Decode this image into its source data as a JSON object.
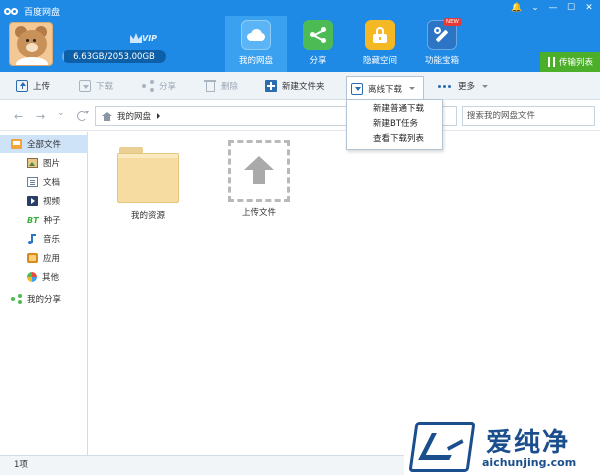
{
  "app": {
    "title": "百度网盘"
  },
  "window_controls": [
    "🔔",
    "⌄",
    "—",
    "☐",
    "✕"
  ],
  "user": {
    "quota_text": "6.63GB/2053.00GB",
    "quota_used_fraction": 0.0032,
    "vip_text": "VIP"
  },
  "nav_tabs": [
    {
      "label": "我的网盘",
      "icon": "cloud-disk-icon",
      "active": true
    },
    {
      "label": "分享",
      "icon": "share-icon",
      "active": false
    },
    {
      "label": "隐藏空间",
      "icon": "lock-icon",
      "active": false
    },
    {
      "label": "功能宝箱",
      "icon": "tools-icon",
      "active": false,
      "badge": "NEW"
    }
  ],
  "transfer_list_label": "传输列表",
  "toolbar": {
    "upload": "上传",
    "download": "下载",
    "share": "分享",
    "delete": "删除",
    "new_folder": "新建文件夹",
    "offline_download": "离线下载",
    "more": "更多"
  },
  "offline_menu": [
    "新建普通下载",
    "新建BT任务",
    "查看下载列表"
  ],
  "address": {
    "back": "←",
    "forward": "→",
    "dropdown": "⌄",
    "path": "我的网盘",
    "search_placeholder": "搜索我的网盘文件"
  },
  "sidebar": {
    "all_files": "全部文件",
    "categories": [
      "图片",
      "文档",
      "视频",
      "种子",
      "音乐",
      "应用",
      "其他"
    ],
    "bt_label": "BT",
    "my_share": "我的分享"
  },
  "files": [
    {
      "name": "我的资源",
      "type": "folder"
    },
    {
      "name": "上传文件",
      "type": "upload"
    }
  ],
  "status": {
    "count": "1项"
  },
  "watermark": {
    "brand": "爱纯净",
    "url": "aichunjing.com"
  },
  "colors": {
    "header": "#1e8ae6",
    "active_tab": "#3aa0f0",
    "transfer_button": "#4caf2a"
  }
}
